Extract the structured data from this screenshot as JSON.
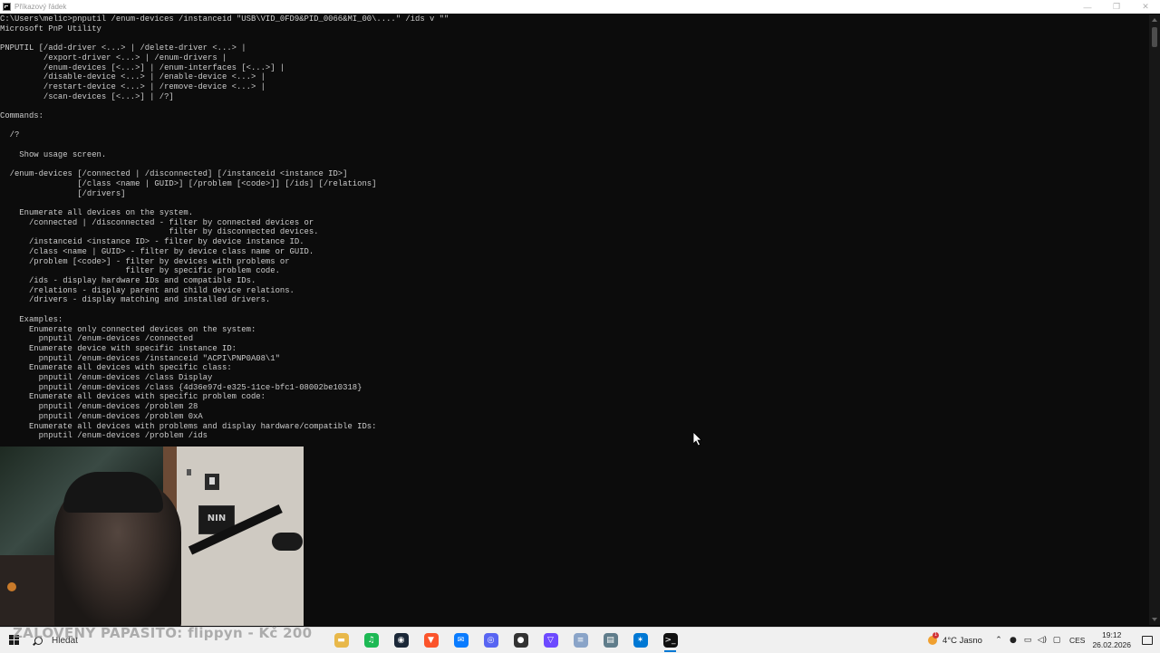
{
  "window": {
    "title": "Příkazový řádek",
    "controls": [
      "—",
      "❐",
      "✕"
    ]
  },
  "console": {
    "text": "C:\\Users\\melic>pnputil /enum-devices /instanceid \"USB\\VID_0FD9&PID_0066&MI_00\\....\" /ids v \"\"\nMicrosoft PnP Utility\n\nPNPUTIL [/add-driver <...> | /delete-driver <...> |\n         /export-driver <...> | /enum-drivers |\n         /enum-devices [<...>] | /enum-interfaces [<...>] |\n         /disable-device <...> | /enable-device <...> |\n         /restart-device <...> | /remove-device <...> |\n         /scan-devices [<...>] | /?]\n\nCommands:\n\n  /?\n\n    Show usage screen.\n\n  /enum-devices [/connected | /disconnected] [/instanceid <instance ID>]\n                [/class <name | GUID>] [/problem [<code>]] [/ids] [/relations]\n                [/drivers]\n\n    Enumerate all devices on the system.\n      /connected | /disconnected - filter by connected devices or\n                                   filter by disconnected devices.\n      /instanceid <instance ID> - filter by device instance ID.\n      /class <name | GUID> - filter by device class name or GUID.\n      /problem [<code>] - filter by devices with problems or\n                          filter by specific problem code.\n      /ids - display hardware IDs and compatible IDs.\n      /relations - display parent and child device relations.\n      /drivers - display matching and installed drivers.\n\n    Examples:\n      Enumerate only connected devices on the system:\n        pnputil /enum-devices /connected\n      Enumerate device with specific instance ID:\n        pnputil /enum-devices /instanceid \"ACPI\\PNP0A08\\1\"\n      Enumerate all devices with specific class:\n        pnputil /enum-devices /class Display\n        pnputil /enum-devices /class {4d36e97d-e325-11ce-bfc1-08002be10318}\n      Enumerate all devices with specific problem code:\n        pnputil /enum-devices /problem 28\n        pnputil /enum-devices /problem 0xA\n      Enumerate all devices with problems and display hardware/compatible IDs:\n        pnputil /enum-devices /problem /ids"
  },
  "webcam": {
    "poster_text": "NIN"
  },
  "taskbar": {
    "search_label": "Hledat",
    "ticker": "ZALOVENY PAPASITO: flippyn - Kč 200",
    "apps": [
      {
        "name": "file-explorer-icon",
        "glyph": "▬",
        "color": "#e8b84a"
      },
      {
        "name": "spotify-icon",
        "glyph": "♫",
        "color": "#1db954"
      },
      {
        "name": "steam-icon",
        "glyph": "◉",
        "color": "#1b2838"
      },
      {
        "name": "brave-icon",
        "glyph": "▼",
        "color": "#fb542b"
      },
      {
        "name": "messenger-icon",
        "glyph": "✉",
        "color": "#0a7cff"
      },
      {
        "name": "discord-icon",
        "glyph": "◎",
        "color": "#5865f2"
      },
      {
        "name": "chrome-icon",
        "glyph": "●",
        "color": "#333333"
      },
      {
        "name": "proton-vpn-icon",
        "glyph": "▽",
        "color": "#6d4aff"
      },
      {
        "name": "notepad-icon",
        "glyph": "≡",
        "color": "#8aa4c8"
      },
      {
        "name": "app-icon",
        "glyph": "▤",
        "color": "#607d8b"
      },
      {
        "name": "vscode-icon",
        "glyph": "✶",
        "color": "#0078d4"
      },
      {
        "name": "terminal-icon",
        "glyph": ">_",
        "color": "#111111"
      }
    ],
    "weather_text": "4°C Jasno",
    "weather_badge": "1",
    "language": "CES",
    "time": "19:12",
    "date": "26.02.2026"
  }
}
